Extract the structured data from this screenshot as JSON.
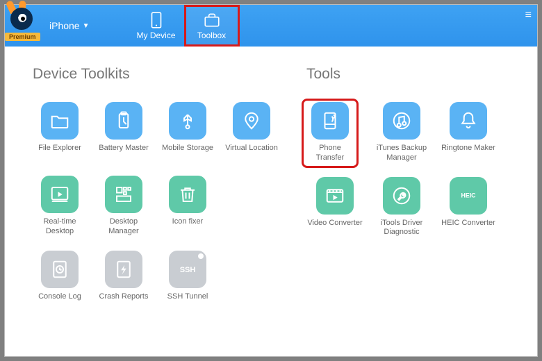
{
  "header": {
    "premium_label": "Premium",
    "device_name": "iPhone",
    "tabs": {
      "my_device": "My Device",
      "toolbox": "Toolbox"
    }
  },
  "sections": {
    "device_toolkits_title": "Device Toolkits",
    "tools_title": "Tools"
  },
  "toolkits": {
    "file_explorer": "File Explorer",
    "battery_master": "Battery Master",
    "mobile_storage": "Mobile Storage",
    "virtual_location": "Virtual Location",
    "realtime_desktop": "Real-time Desktop",
    "desktop_manager": "Desktop Manager",
    "icon_fixer": "Icon fixer",
    "console_log": "Console Log",
    "crash_reports": "Crash Reports",
    "ssh_tunnel": "SSH Tunnel"
  },
  "tools": {
    "phone_transfer": "Phone Transfer",
    "itunes_backup_manager": "iTunes Backup Manager",
    "ringtone_maker": "Ringtone Maker",
    "video_converter": "Video Converter",
    "itools_driver_diagnostic": "iTools Driver Diagnostic",
    "heic_converter": "HEIC Converter",
    "heic_badge": "HEIC"
  },
  "colors": {
    "accent_blue": "#5ab3f4",
    "accent_green": "#5fc9a8",
    "neutral_gray": "#c9cdd2",
    "highlight_red": "#d61a1a"
  }
}
